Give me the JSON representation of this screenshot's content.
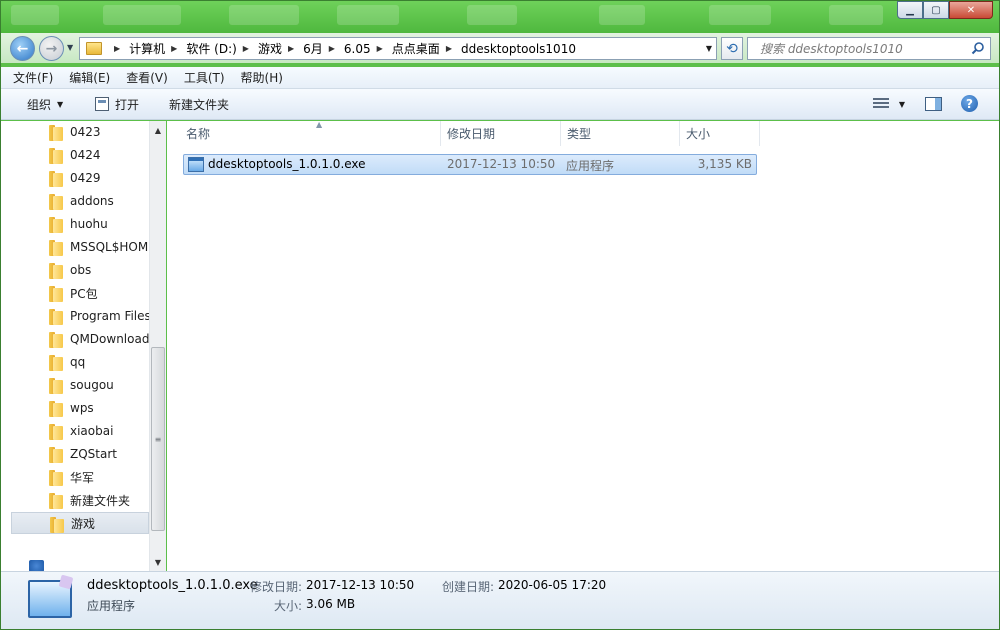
{
  "titlebar": {
    "caption_buttons": {
      "minimize": "▁",
      "maximize": "▢",
      "close": "✕"
    }
  },
  "address": {
    "breadcrumbs": [
      "计算机",
      "软件 (D:)",
      "游戏",
      "6月",
      "6.05",
      "点点桌面",
      "ddesktoptools1010"
    ],
    "refresh_icon": "refresh-icon",
    "search_placeholder": "搜索 ddesktoptools1010"
  },
  "menu": {
    "items": [
      "文件(F)",
      "编辑(E)",
      "查看(V)",
      "工具(T)",
      "帮助(H)"
    ]
  },
  "commandbar": {
    "organize": "组织",
    "open": "打开",
    "new_folder": "新建文件夹",
    "help": "?"
  },
  "nav": {
    "items": [
      "0423",
      "0424",
      "0429",
      "addons",
      "huohu",
      "MSSQL$HOM",
      "obs",
      "PC包",
      "Program Files",
      "QMDownload",
      "qq",
      "sougou",
      "wps",
      "xiaobai",
      "ZQStart",
      "华军",
      "新建文件夹",
      "游戏"
    ],
    "selected": "游戏",
    "network_partial": "网络"
  },
  "columns": {
    "name": "名称",
    "date": "修改日期",
    "type": "类型",
    "size": "大小"
  },
  "files": [
    {
      "name": "ddesktoptools_1.0.1.0.exe",
      "date": "2017-12-13 10:50",
      "type": "应用程序",
      "size": "3,135 KB"
    }
  ],
  "details": {
    "name": "ddesktoptools_1.0.1.0.exe",
    "type": "应用程序",
    "modified_label": "修改日期:",
    "modified_value": "2017-12-13 10:50",
    "created_label": "创建日期:",
    "created_value": "2020-06-05 17:20",
    "size_label": "大小:",
    "size_value": "3.06 MB"
  },
  "colors": {
    "title_green": "#5cbf4a",
    "selection_blue": "#c1dcf7"
  }
}
